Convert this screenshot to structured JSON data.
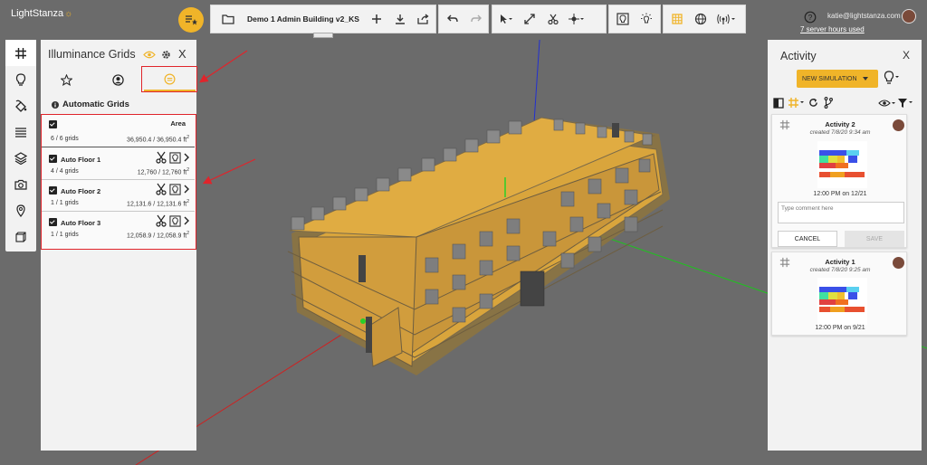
{
  "app": {
    "logo_text": "LightStanza"
  },
  "toolbar": {
    "project_name": "Demo 1 Admin Building v2_KS",
    "file_icon": "folder-icon",
    "add_icon": "plus-icon",
    "download_icon": "download-icon",
    "share_icon": "share-icon",
    "undo_icon": "undo-icon",
    "redo_icon": "redo-icon",
    "select_icon": "cursor-icon",
    "expand_icon": "expand-icon",
    "cut_icon": "scissors-icon",
    "move_icon": "move-icon",
    "light_icon": "bulb-frame-icon",
    "sun_icon": "sun-icon",
    "grid_icon": "grid-cube-icon",
    "globe_icon": "globe-icon",
    "signal_icon": "signal-icon"
  },
  "user": {
    "email": "katie@lightstanza.com",
    "server_hours": "7 server hours used"
  },
  "left_rail": {
    "items": [
      "grid-icon",
      "bulb-icon",
      "paint-icon",
      "layers-icon",
      "stack-icon",
      "camera-icon",
      "pin-icon",
      "cube-icon"
    ]
  },
  "grids_panel": {
    "title": "Illuminance Grids",
    "close": "X",
    "tabs": [
      "star-icon",
      "user-circle-icon",
      "grid-sun-icon"
    ],
    "section_title": "Automatic Grids",
    "area_header": "Area",
    "summary": {
      "count": "6 / 6 grids",
      "area": "36,950.4 / 36,950.4 ft",
      "unit_sup": "2"
    },
    "rows": [
      {
        "name": "Auto Floor 1",
        "count": "4 / 4 grids",
        "area": "12,760 / 12,760 ft",
        "unit_sup": "2"
      },
      {
        "name": "Auto Floor 2",
        "count": "1 / 1 grids",
        "area": "12,131.6 / 12,131.6 ft",
        "unit_sup": "2"
      },
      {
        "name": "Auto Floor 3",
        "count": "1 / 1 grids",
        "area": "12,058.9 / 12,058.9 ft",
        "unit_sup": "2"
      }
    ]
  },
  "activity_panel": {
    "title": "Activity",
    "close": "X",
    "new_simulation": "NEW SIMULATION",
    "cards": [
      {
        "title": "Activity 2",
        "created": "created 7/8/20 9:34 am",
        "time": "12:00 PM on 12/21",
        "comment_placeholder": "Type comment here",
        "cancel": "CANCEL",
        "save": "SAVE"
      },
      {
        "title": "Activity 1",
        "created": "created 7/8/20 9:25 am",
        "time": "12:00 PM on 9/21"
      }
    ]
  },
  "colors": {
    "accent": "#f0b429",
    "annotation": "#e0242b",
    "building": "#d9a53c"
  }
}
